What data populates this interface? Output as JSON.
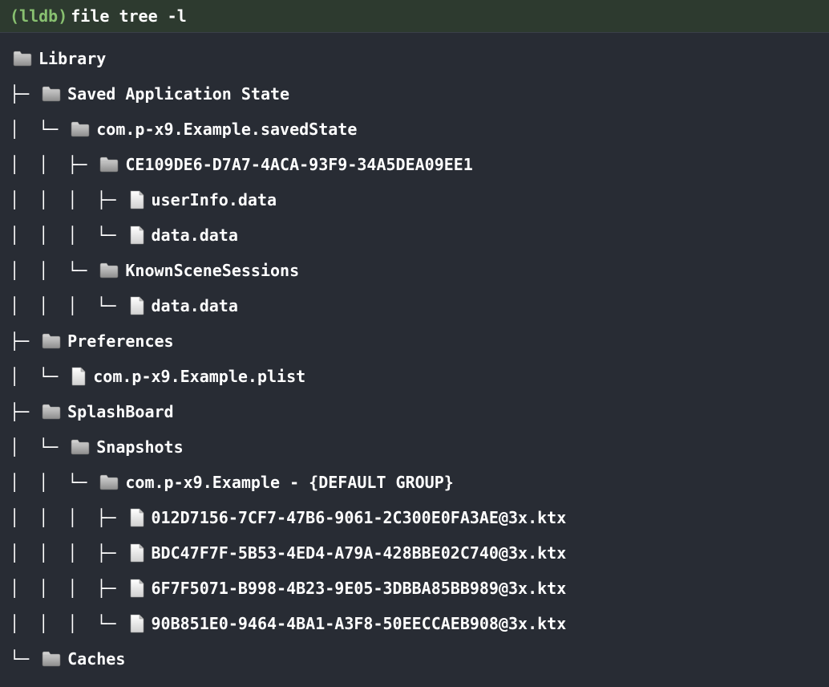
{
  "prompt": {
    "label": "(lldb)",
    "command": "file tree -l"
  },
  "rows": [
    {
      "prefix": "",
      "type": "folder",
      "name": "Library"
    },
    {
      "prefix": "├─ ",
      "type": "folder",
      "name": "Saved Application State"
    },
    {
      "prefix": "│  └─ ",
      "type": "folder",
      "name": "com.p-x9.Example.savedState"
    },
    {
      "prefix": "│  │  ├─ ",
      "type": "folder",
      "name": "CE109DE6-D7A7-4ACA-93F9-34A5DEA09EE1"
    },
    {
      "prefix": "│  │  │  ├─ ",
      "type": "file",
      "name": "userInfo.data"
    },
    {
      "prefix": "│  │  │  └─ ",
      "type": "file",
      "name": "data.data"
    },
    {
      "prefix": "│  │  └─ ",
      "type": "folder",
      "name": "KnownSceneSessions"
    },
    {
      "prefix": "│  │  │  └─ ",
      "type": "file",
      "name": "data.data"
    },
    {
      "prefix": "├─ ",
      "type": "folder",
      "name": "Preferences"
    },
    {
      "prefix": "│  └─ ",
      "type": "file",
      "name": "com.p-x9.Example.plist"
    },
    {
      "prefix": "├─ ",
      "type": "folder",
      "name": "SplashBoard"
    },
    {
      "prefix": "│  └─ ",
      "type": "folder",
      "name": "Snapshots"
    },
    {
      "prefix": "│  │  └─ ",
      "type": "folder",
      "name": "com.p-x9.Example - {DEFAULT GROUP}"
    },
    {
      "prefix": "│  │  │  ├─ ",
      "type": "file",
      "name": "012D7156-7CF7-47B6-9061-2C300E0FA3AE@3x.ktx"
    },
    {
      "prefix": "│  │  │  ├─ ",
      "type": "file",
      "name": "BDC47F7F-5B53-4ED4-A79A-428BBE02C740@3x.ktx"
    },
    {
      "prefix": "│  │  │  ├─ ",
      "type": "file",
      "name": "6F7F5071-B998-4B23-9E05-3DBBA85BB989@3x.ktx"
    },
    {
      "prefix": "│  │  │  └─ ",
      "type": "file",
      "name": "90B851E0-9464-4BA1-A3F8-50EECCAEB908@3x.ktx"
    },
    {
      "prefix": "└─ ",
      "type": "folder",
      "name": "Caches"
    }
  ]
}
